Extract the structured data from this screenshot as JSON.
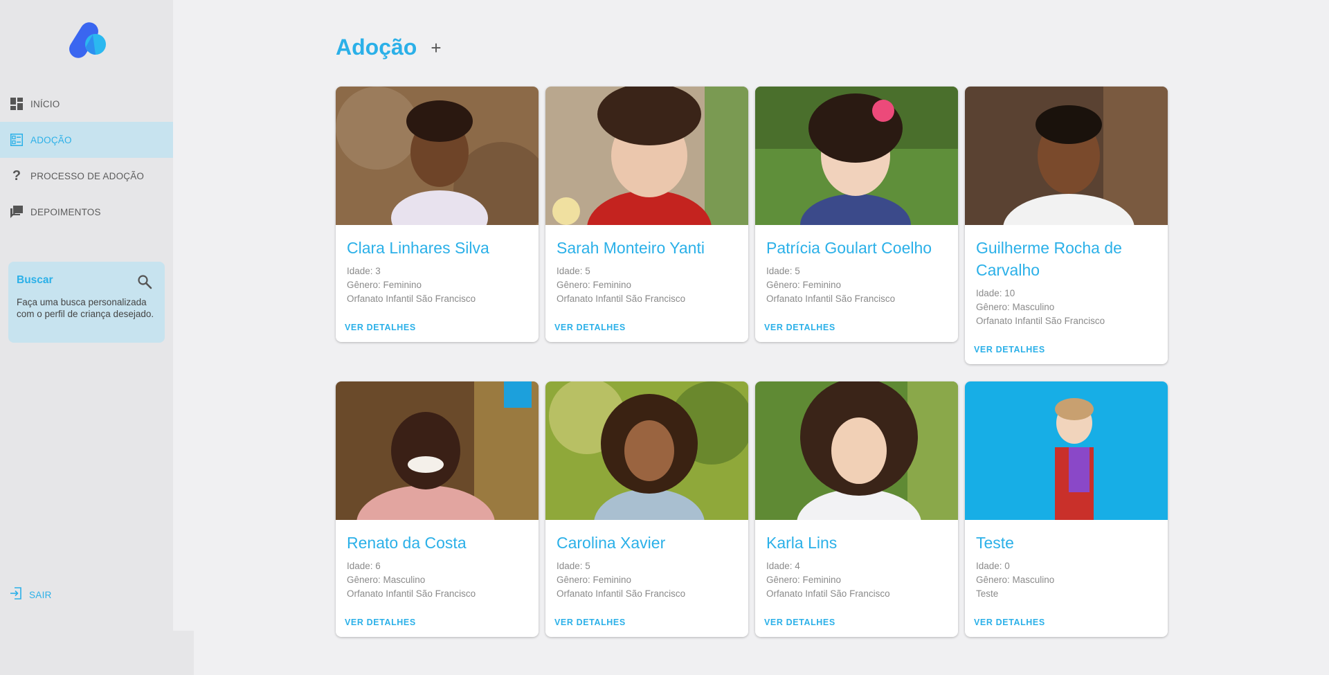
{
  "colors": {
    "accent": "#2bb0e8",
    "sidebar_bg": "#e6e6e8",
    "active_bg": "#c7e3ef",
    "page_bg": "#f0f0f2"
  },
  "sidebar": {
    "items": [
      {
        "label": "INÍCIO",
        "icon": "dashboard-icon",
        "active": false
      },
      {
        "label": "ADOÇÃO",
        "icon": "list-icon",
        "active": true
      },
      {
        "label": "PROCESSO DE ADOÇÃO",
        "icon": "question-icon",
        "active": false
      },
      {
        "label": "DEPOIMENTOS",
        "icon": "chat-icon",
        "active": false
      }
    ],
    "search": {
      "title": "Buscar",
      "description": "Faça uma busca personalizada com o perfil de criança desejado."
    },
    "logout_label": "SAIR"
  },
  "main": {
    "title": "Adoção",
    "add_label": "+",
    "cards": [
      {
        "name": "Clara Linhares Silva",
        "age": "Idade: 3",
        "gender": "Gênero: Feminino",
        "institution": "Orfanato Infantil São Francisco",
        "action": "VER DETALHES"
      },
      {
        "name": "Sarah Monteiro Yanti",
        "age": "Idade: 5",
        "gender": "Gênero: Feminino",
        "institution": "Orfanato Infantil São Francisco",
        "action": "VER DETALHES"
      },
      {
        "name": "Patrícia Goulart Coelho",
        "age": "Idade: 5",
        "gender": "Gênero: Feminino",
        "institution": "Orfanato Infantil São Francisco",
        "action": "VER DETALHES"
      },
      {
        "name": "Guilherme Rocha de Carvalho",
        "age": "Idade: 10",
        "gender": "Gênero: Masculino",
        "institution": "Orfanato Infantil São Francisco",
        "action": "VER DETALHES"
      },
      {
        "name": "Renato da Costa",
        "age": "Idade: 6",
        "gender": "Gênero: Masculino",
        "institution": "Orfanato Infantil São Francisco",
        "action": "VER DETALHES"
      },
      {
        "name": "Carolina Xavier",
        "age": "Idade: 5",
        "gender": "Gênero: Feminino",
        "institution": "Orfanato Infantil São Francisco",
        "action": "VER DETALHES"
      },
      {
        "name": "Karla Lins",
        "age": "Idade: 4",
        "gender": "Gênero: Feminino",
        "institution": "Orfanato Infatil São Francisco",
        "action": "VER DETALHES"
      },
      {
        "name": "Teste",
        "age": "Idade: 0",
        "gender": "Gênero: Masculino",
        "institution": "Teste",
        "action": "VER DETALHES"
      }
    ]
  }
}
